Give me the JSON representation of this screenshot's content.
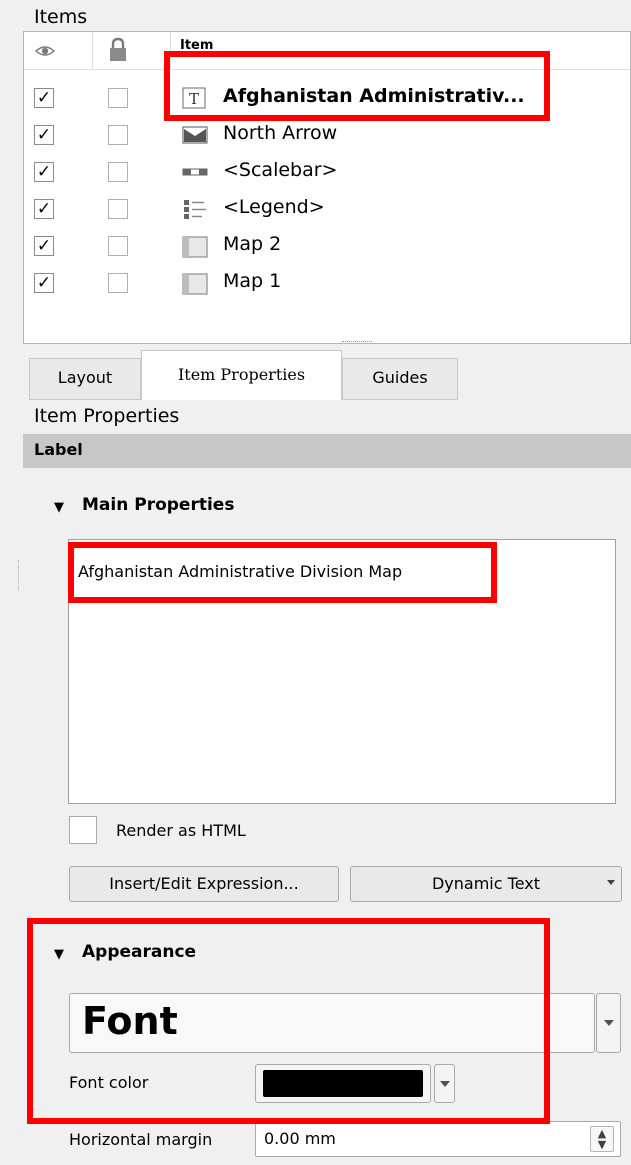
{
  "items_panel": {
    "title": "Items",
    "header_item": "Item",
    "rows": [
      {
        "label": "Afghanistan Administrativ...",
        "icon": "text-label-icon",
        "visible": true,
        "locked": false,
        "selected": true
      },
      {
        "label": "North Arrow",
        "icon": "picture-icon",
        "visible": true,
        "locked": false
      },
      {
        "label": "<Scalebar>",
        "icon": "scalebar-icon",
        "visible": true,
        "locked": false
      },
      {
        "label": "<Legend>",
        "icon": "legend-icon",
        "visible": true,
        "locked": false
      },
      {
        "label": "Map 2",
        "icon": "map-icon",
        "visible": true,
        "locked": false
      },
      {
        "label": "Map 1",
        "icon": "map-icon",
        "visible": true,
        "locked": false
      }
    ],
    "check_mark": "✓"
  },
  "tabs": [
    {
      "label": "Layout",
      "active": false
    },
    {
      "label": "Item Properties",
      "active": true
    },
    {
      "label": "Guides",
      "active": false
    }
  ],
  "item_properties": {
    "title": "Item Properties",
    "label_bar": "Label",
    "main_properties": {
      "heading": "Main Properties",
      "text": "Afghanistan Administrative Division Map",
      "render_html_label": "Render as HTML",
      "render_html_checked": false,
      "insert_expression_button": "Insert/Edit Expression...",
      "dynamic_text_button": "Dynamic Text"
    },
    "appearance": {
      "heading": "Appearance",
      "font_button": "Font",
      "font_color_label": "Font color",
      "font_color": "#000000",
      "horizontal_margin_label": "Horizontal margin",
      "horizontal_margin_value": "0.00 mm"
    }
  },
  "highlight_color": "#ff0000"
}
